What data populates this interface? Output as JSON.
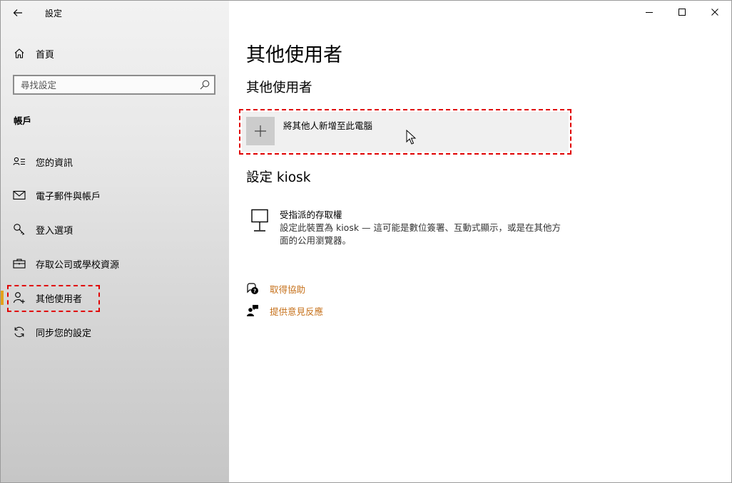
{
  "window": {
    "app_title": "設定"
  },
  "sidebar": {
    "home_label": "首頁",
    "search_placeholder": "尋找設定",
    "section_title": "帳戶",
    "items": [
      {
        "label": "您的資訊",
        "icon": "person-info-icon"
      },
      {
        "label": "電子郵件與帳戶",
        "icon": "mail-icon"
      },
      {
        "label": "登入選項",
        "icon": "key-icon"
      },
      {
        "label": "存取公司或學校資源",
        "icon": "briefcase-icon"
      },
      {
        "label": "其他使用者",
        "icon": "add-person-icon",
        "active": true
      },
      {
        "label": "同步您的設定",
        "icon": "sync-icon"
      }
    ]
  },
  "main": {
    "page_title": "其他使用者",
    "sub_title": "其他使用者",
    "add_user_label": "將其他人新增至此電腦",
    "kiosk_title": "設定 kiosk",
    "kiosk_item_title": "受指派的存取權",
    "kiosk_item_desc": "設定此裝置為 kiosk — 這可能是數位簽署、互動式顯示，或是在其他方面的公用瀏覽器。",
    "help_links": [
      {
        "label": "取得協助",
        "icon": "help-chat-icon"
      },
      {
        "label": "提供意見反應",
        "icon": "feedback-icon"
      }
    ]
  },
  "colors": {
    "accent": "#e3a21a",
    "link": "#c6711b",
    "annotation": "#e00000"
  }
}
